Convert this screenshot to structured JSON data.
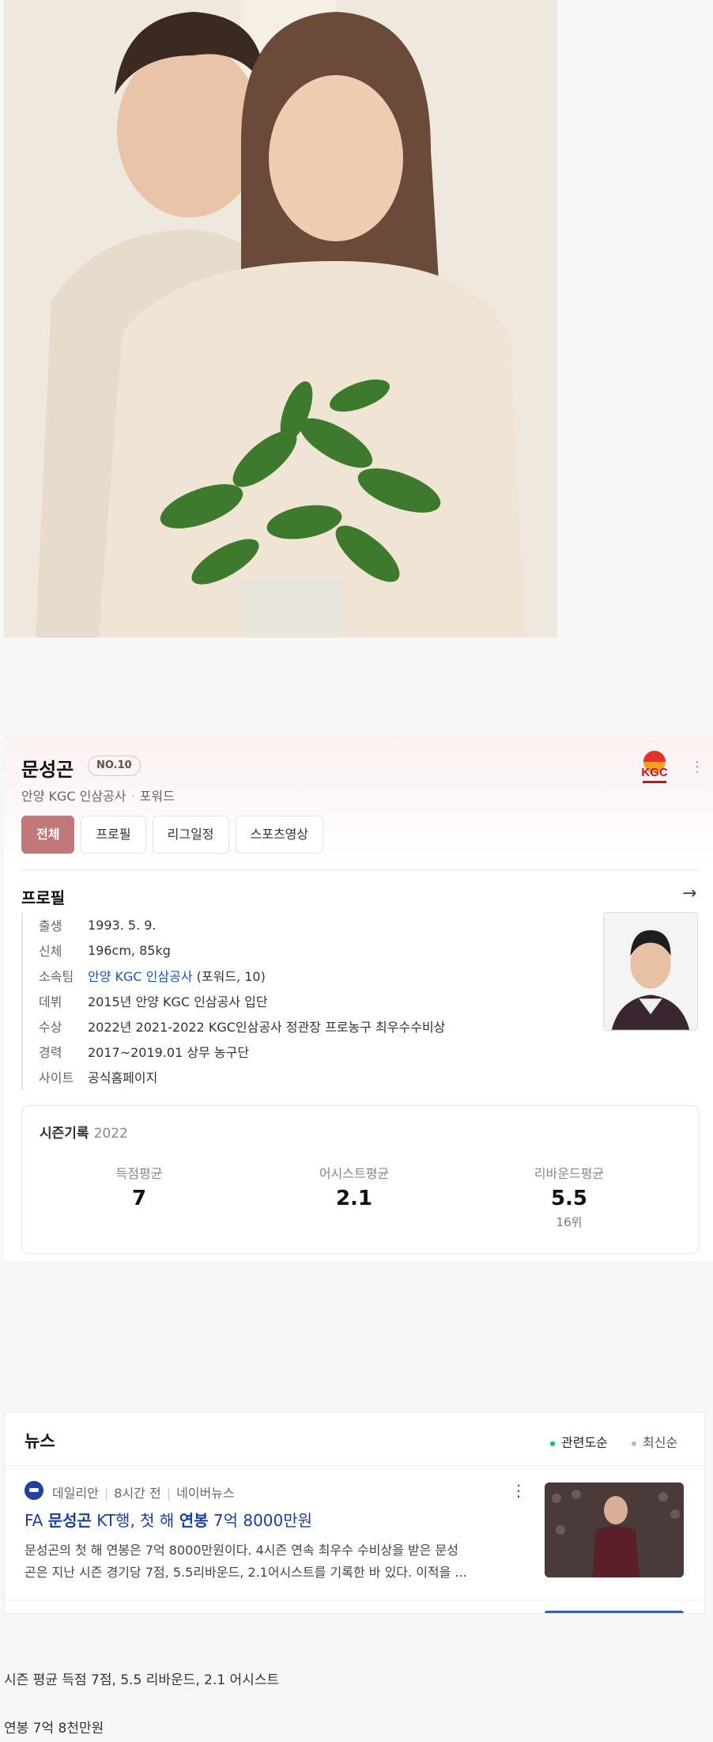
{
  "player": {
    "name": "문성곤",
    "number": "NO.10",
    "team": "안양 KGC 인삼공사",
    "position": "포워드",
    "team_logo_text": "KGC"
  },
  "tabs": [
    "전체",
    "프로필",
    "리그일정",
    "스포츠영상"
  ],
  "profile": {
    "title": "프로필",
    "rows": [
      {
        "key": "출생",
        "value": "1993. 5. 9."
      },
      {
        "key": "신체",
        "value": "196cm, 85kg"
      },
      {
        "key": "소속팀",
        "value_link": "안양 KGC 인삼공사",
        "value": " (포워드, 10)"
      },
      {
        "key": "데뷔",
        "value": "2015년 안양 KGC 인삼공사 입단"
      },
      {
        "key": "수상",
        "value": "2022년 2021-2022 KGC인삼공사 정관장 프로농구 최우수수비상"
      },
      {
        "key": "경력",
        "value": "2017~2019.01 상무 농구단"
      },
      {
        "key": "사이트",
        "value_link": "공식홈페이지"
      }
    ]
  },
  "season": {
    "title": "시즌기록",
    "year": "2022",
    "stats": [
      {
        "label": "득점평균",
        "value": "7"
      },
      {
        "label": "어시스트평균",
        "value": "2.1"
      },
      {
        "label": "리바운드평균",
        "value": "5.5",
        "rank": "16위"
      }
    ]
  },
  "news": {
    "title": "뉴스",
    "sort_options": [
      {
        "label": "관련도순",
        "active": true,
        "color": "#03c75a"
      },
      {
        "label": "최신순",
        "active": false,
        "color": "#bbbbbb"
      }
    ],
    "article": {
      "press": "데일리안",
      "time": "8시간 전",
      "source": "네이버뉴스",
      "headline_parts": [
        "FA ",
        "문성곤",
        " KT행, 첫 해 ",
        "연봉",
        " 7억 8000만원"
      ],
      "snippet_line1": "문성곤의 첫 해 연봉은 7억 8000만원이다. 4시즌 연속 최우수 수비상을 받은 문성",
      "snippet_line2": "곤은 지난 시즌 경기당 7점, 5.5리바운드, 2.1어시스트를 기록한 바 있다. 이적을 ..."
    }
  },
  "captions": [
    "시즌 평균 득점 7점, 5.5 리바운드, 2.1 어시스트",
    "연봉 7억 8천만원"
  ]
}
